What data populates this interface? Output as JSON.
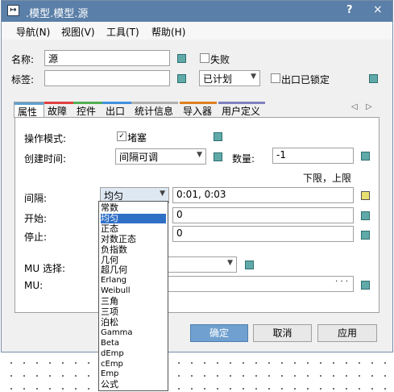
{
  "window": {
    "title": ".模型.模型.源",
    "app_icon": "app-arrow-icon",
    "help_glyph": "?",
    "close_glyph": "×"
  },
  "menu": [
    "导航(N)",
    "视图(V)",
    "工具(T)",
    "帮助(H)"
  ],
  "form": {
    "name_label": "名称:",
    "name_value": "源",
    "failed_label": "失败",
    "tag_label": "标签:",
    "tag_value": "",
    "plan_value": "已计划",
    "exit_locked_label": "出口已锁定"
  },
  "tabs": [
    {
      "label": "属性",
      "color": "#5fa0d0"
    },
    {
      "label": "故障",
      "color": "#e04040"
    },
    {
      "label": "控件",
      "color": "#50b050"
    },
    {
      "label": "出口",
      "color": "#4090e0"
    },
    {
      "label": "统计信息",
      "color": "#b0b0b0"
    },
    {
      "label": "导入器",
      "color": "#e08020"
    },
    {
      "label": "用户定义",
      "color": "#8080c0"
    }
  ],
  "tab_nav": {
    "prev": "◁",
    "next": "▷"
  },
  "props": {
    "mode_label": "操作模式:",
    "blocked_label": "堵塞",
    "created_label": "创建时间:",
    "created_value": "间隔可调",
    "qty_label": "数量:",
    "qty_value": "-1",
    "limits_label": "下限，上限",
    "interval_label": "间隔:",
    "interval_dist": "均匀",
    "interval_value": "0:01, 0:03",
    "start_label": "开始:",
    "start_value": "0",
    "stop_label": "停止:",
    "stop_value": "0",
    "mu_select_label": "MU 选择:",
    "mu_label": "MU:",
    "mu_browse": "· · ·"
  },
  "dropdown_options": [
    "常数",
    "均匀",
    "正态",
    "对数正态",
    "负指数",
    "几何",
    "超几何",
    "Erlang",
    "Weibull",
    "三角",
    "三项",
    "泊松",
    "Gamma",
    "Beta",
    "dEmp",
    "cEmp",
    "Emp",
    "公式"
  ],
  "dropdown_selected": "均匀",
  "buttons": {
    "ok": "确定",
    "cancel": "取消",
    "apply": "应用"
  }
}
